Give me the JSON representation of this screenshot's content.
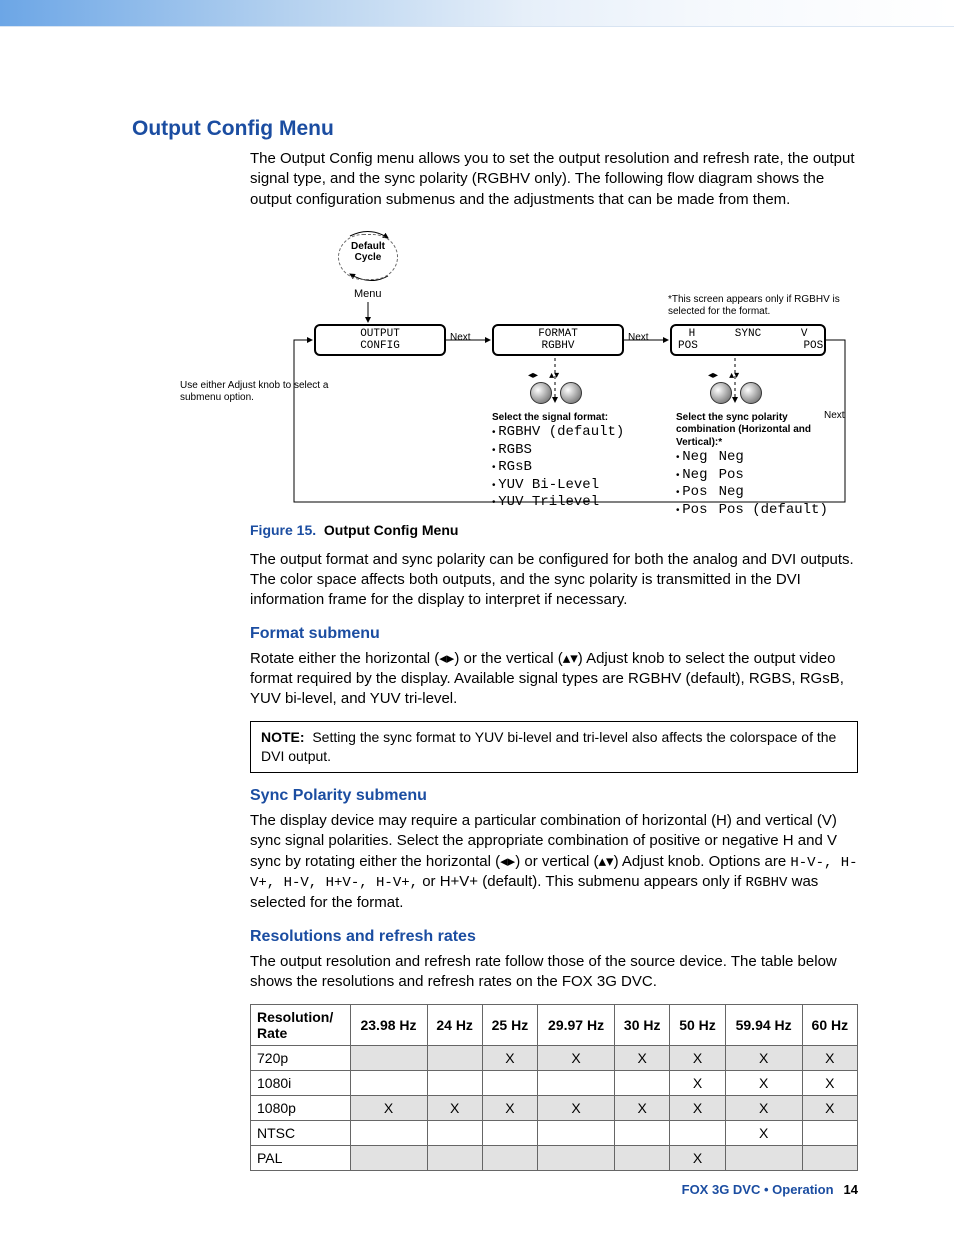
{
  "h1": "Output Config Menu",
  "intro": "The Output Config menu allows you to set the output resolution and refresh rate, the output signal type, and the sync polarity (RGBHV only). The following flow diagram shows the output configuration submenus and the adjustments that can be made from them.",
  "figure": {
    "label": "Figure 15.",
    "desc": "Output Config Menu"
  },
  "p2": "The output format and sync polarity can be configured for both the analog and DVI outputs. The color space affects both outputs, and the sync polarity is transmitted in the DVI information frame for the display to interpret if necessary.",
  "h2a": "Format submenu",
  "p3": "Rotate either the horizontal (◂▸) or the vertical (▴▾) Adjust knob to select the output video format required by the display. Available signal types are RGBHV (default), RGBS, RGsB, YUV bi-level, and YUV tri-level.",
  "note": {
    "label": "NOTE:",
    "text": "Setting the sync format to YUV bi-level and tri-level also affects the colorspace of the DVI output."
  },
  "h2b": "Sync Polarity submenu",
  "p4a": "The display device may require a particular combination of horizontal (H) and vertical (V) sync signal polarities. Select the appropriate combination of positive or negative H and V sync by rotating either the horizontal (◂▸) or vertical (▴▾) Adjust knob. Options are ",
  "p4opts": "H-V-, H-V+, H-V, H+V-, H-V+,",
  "p4b": " or H+V+ (default). This submenu appears only if ",
  "p4c": "RGBHV",
  "p4d": " was selected for the format.",
  "h2c": "Resolutions and refresh rates",
  "p5": "The output resolution and refresh rate follow those of the source device. The table below shows the resolutions and refresh rates on the FOX 3G DVC.",
  "table": {
    "head": [
      "Resolution/ Rate",
      "23.98 Hz",
      "24 Hz",
      "25 Hz",
      "29.97 Hz",
      "30 Hz",
      "50 Hz",
      "59.94 Hz",
      "60 Hz"
    ],
    "rows": [
      {
        "gray": true,
        "cells": [
          "720p",
          "",
          "",
          "X",
          "X",
          "X",
          "X",
          "X",
          "X"
        ]
      },
      {
        "gray": false,
        "cells": [
          "1080i",
          "",
          "",
          "",
          "",
          "",
          "X",
          "X",
          "X"
        ]
      },
      {
        "gray": true,
        "cells": [
          "1080p",
          "X",
          "X",
          "X",
          "X",
          "X",
          "X",
          "X",
          "X"
        ]
      },
      {
        "gray": false,
        "cells": [
          "NTSC",
          "",
          "",
          "",
          "",
          "",
          "",
          "X",
          ""
        ]
      },
      {
        "gray": true,
        "cells": [
          "PAL",
          "",
          "",
          "",
          "",
          "",
          "X",
          "",
          ""
        ]
      }
    ]
  },
  "footer": {
    "title": "FOX 3G DVC • Operation",
    "page": "14"
  },
  "diag": {
    "default": "Default Cycle",
    "menu": "Menu",
    "lcd1a": "OUTPUT",
    "lcd1b": "CONFIG",
    "next": "Next",
    "lcd2a": "FORMAT",
    "lcd2b": "RGBHV",
    "lcd3a": "H",
    "lcd3b": "SYNC",
    "lcd3c": "V",
    "lcd3d": "POS",
    "lcd3e": "POS",
    "hint": "Use either Adjust knob to select a submenu option.",
    "star": "*This screen appears only if RGBHV is selected for the format.",
    "fmttitle": "Select the signal format:",
    "fmt": [
      "RGBHV (default)",
      "RGBS",
      "RGsB",
      "YUV Bi-Level",
      "YUV Trilevel"
    ],
    "synctitle": "Select the sync polarity combination (Horizontal and Vertical):*",
    "sync": [
      [
        "Neg",
        "Neg"
      ],
      [
        "Neg",
        "Pos"
      ],
      [
        "Pos",
        "Neg"
      ],
      [
        "Pos",
        "Pos (default)"
      ]
    ]
  }
}
